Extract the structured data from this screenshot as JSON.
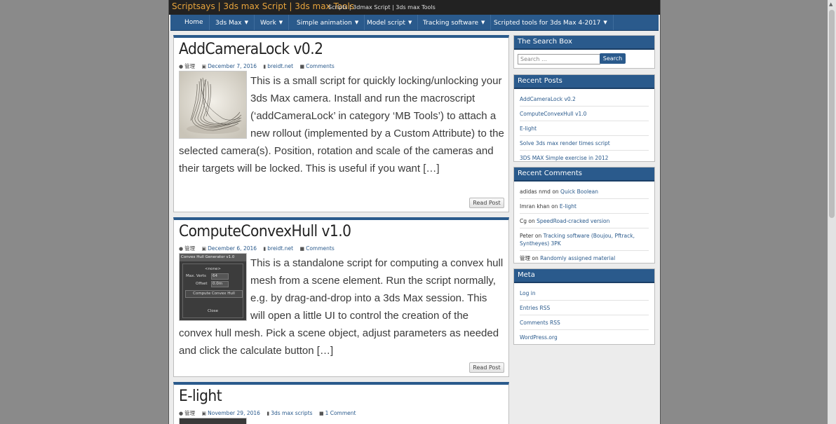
{
  "header": {
    "site_title": "Scriptsays | 3ds max Script | 3ds max Tools",
    "site_description": "Scripts | 3dmax Script | 3ds max Tools"
  },
  "nav": {
    "items": [
      {
        "label": "Home"
      },
      {
        "label": "3ds Max"
      },
      {
        "label": "Work"
      },
      {
        "label": "Simple animation"
      },
      {
        "label": "Model script"
      },
      {
        "label": "Tracking software"
      },
      {
        "label": "Scripted tools for 3ds Max 4-2017"
      }
    ]
  },
  "posts": [
    {
      "title": "AddCameraLock v0.2",
      "author": "管理",
      "date": "December 7, 2016",
      "category": "breidt.net",
      "comments": "Comments",
      "excerpt": "This is a small script for quickly locking/unlocking your 3ds Max camera. Install and run the macroscript (‘addCameraLock’ in category ‘MB Tools’) to attach a new rollout (implemented by a Custom Attribute) to the selected camera(s). Position, rotation and scale of the cameras and their targets will be locked. This is useful if you want […]",
      "read_more": "Read Post"
    },
    {
      "title": "ComputeConvexHull v1.0",
      "author": "管理",
      "date": "December 6, 2016",
      "category": "breidt.net",
      "comments": "Comments",
      "excerpt": "This is a standalone script for computing a convex hull mesh from a scene element. Run the script normally, e.g. by drag-and-drop into a 3ds Max session. This will open a little UI to control the creation of the convex hull mesh. Pick a scene object, adjust parameters as needed and click the calculate button […]",
      "read_more": "Read Post",
      "thumb_ui": {
        "title": "Convex Hull Generator v1.0",
        "none": "<none>",
        "max_verts_label": "Max. Verts",
        "max_verts_value": "64",
        "offset_label": "Offset",
        "offset_value": "0.0m",
        "compute": "Compute Convex Hull",
        "close": "Close"
      }
    },
    {
      "title": "E-light",
      "author": "管理",
      "date": "November 29, 2016",
      "category": "3ds max scripts",
      "comments": "1 Comment"
    }
  ],
  "sidebar": {
    "search": {
      "title": "The Search Box",
      "placeholder": "Search …",
      "button": "Search"
    },
    "recent_posts": {
      "title": "Recent Posts",
      "items": [
        "AddCameraLock v0.2",
        "ComputeConvexHull v1.0",
        "E-light",
        "Solve 3ds max render times script",
        "3DS MAX Simple exercise in 2012"
      ]
    },
    "recent_comments": {
      "title": "Recent Comments",
      "items": [
        {
          "author": "adidas nmd",
          "on": "on",
          "post": "Quick Boolean"
        },
        {
          "author": "Imran khan",
          "on": "on",
          "post": "E-light"
        },
        {
          "author": "Cg",
          "on": "on",
          "post": "SpeedRoad-cracked version"
        },
        {
          "author": "Peter",
          "on": "on",
          "post": "Tracking software (Boujou, Pftrack, Syntheyes) 3PK"
        },
        {
          "author": "管理",
          "on": "on",
          "post": "Randomly assigned material"
        }
      ]
    },
    "meta": {
      "title": "Meta",
      "items": [
        "Log in",
        "Entries RSS",
        "Comments RSS",
        "WordPress.org"
      ]
    }
  },
  "colors": {
    "nav_blue": "#2a5a8c",
    "title_orange": "#e8a43c",
    "topbar": "#222222"
  }
}
